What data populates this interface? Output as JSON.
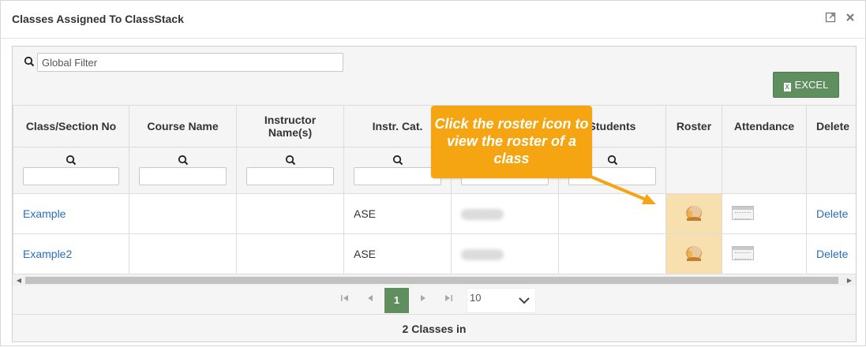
{
  "dialog": {
    "title": "Classes Assigned To ClassStack",
    "maximize_icon": "maximize-icon",
    "close_icon": "close-icon"
  },
  "toolbar": {
    "filter_placeholder": "Global Filter",
    "filter_value": "Global Filter",
    "excel_label": "EXCEL",
    "excel_color": "#5f8f5f"
  },
  "columns": [
    "Class/Section No",
    "Course Name",
    "Instructor Name(s)",
    "Instr. Cat.",
    "",
    "Students",
    "Roster",
    "Attendance",
    "Delete"
  ],
  "rows": [
    {
      "class_no": "Example",
      "course_name": "",
      "instructor": "",
      "instr_cat": "ASE",
      "col5_blurred": "Content",
      "students": "",
      "roster_icon": "roster-icon",
      "attendance_icon": "calendar-icon",
      "delete": "Delete"
    },
    {
      "class_no": "Example2",
      "course_name": "",
      "instructor": "",
      "instr_cat": "ASE",
      "col5_blurred": "Content",
      "students": "",
      "roster_icon": "roster-icon",
      "attendance_icon": "calendar-icon",
      "delete": "Delete"
    }
  ],
  "pager": {
    "current_page": "1",
    "page_size": "10"
  },
  "footer": {
    "count_text": "2 Classes in"
  },
  "callout": {
    "text": "Click the roster icon to view the roster of a class",
    "color": "#f5a511"
  },
  "highlight_color": "#f8e0ae",
  "link_color": "#2a6ebb"
}
